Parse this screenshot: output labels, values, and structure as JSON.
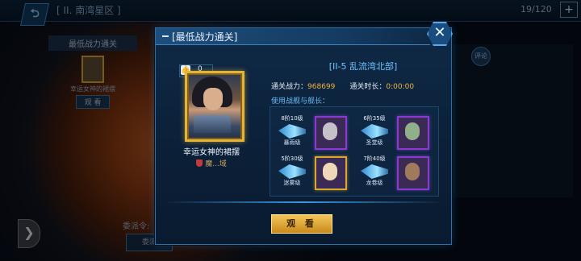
{
  "background": {
    "region_title": "[ II. 南湾星区 ]",
    "energy": "19/120",
    "energy_add": "+",
    "side_panel": {
      "header": "最低战力通关",
      "captain_name": "幸运女神的裙摆",
      "view_button": "观 看"
    },
    "comment_badge": "评论",
    "bottom_label": "委派令:",
    "bottom_button": "委派"
  },
  "modal": {
    "title": "[最低战力通关]",
    "close_label": "✕",
    "likes": "0",
    "player_name": "幸运女神的裙摆",
    "server": "魔...域",
    "stage_name": "[II-5 乱流湾北部]",
    "power_label": "通关战力：",
    "power_value": "968699",
    "time_label": "通关时长：",
    "time_value": "0:00:00",
    "used_label": "使用战舰与舰长：",
    "ships": [
      {
        "level": "8阶10级",
        "class": "暴雨级"
      },
      {
        "level": "6阶35级",
        "class": "圣堂级"
      },
      {
        "level": "5阶30级",
        "class": "迷雾级"
      },
      {
        "level": "7阶40级",
        "class": "龙卷级"
      }
    ],
    "watch_button": "观 看"
  },
  "colors": {
    "accent_blue": "#3a96e0",
    "gold": "#e3b43a",
    "power_orange": "#f0b43c"
  }
}
